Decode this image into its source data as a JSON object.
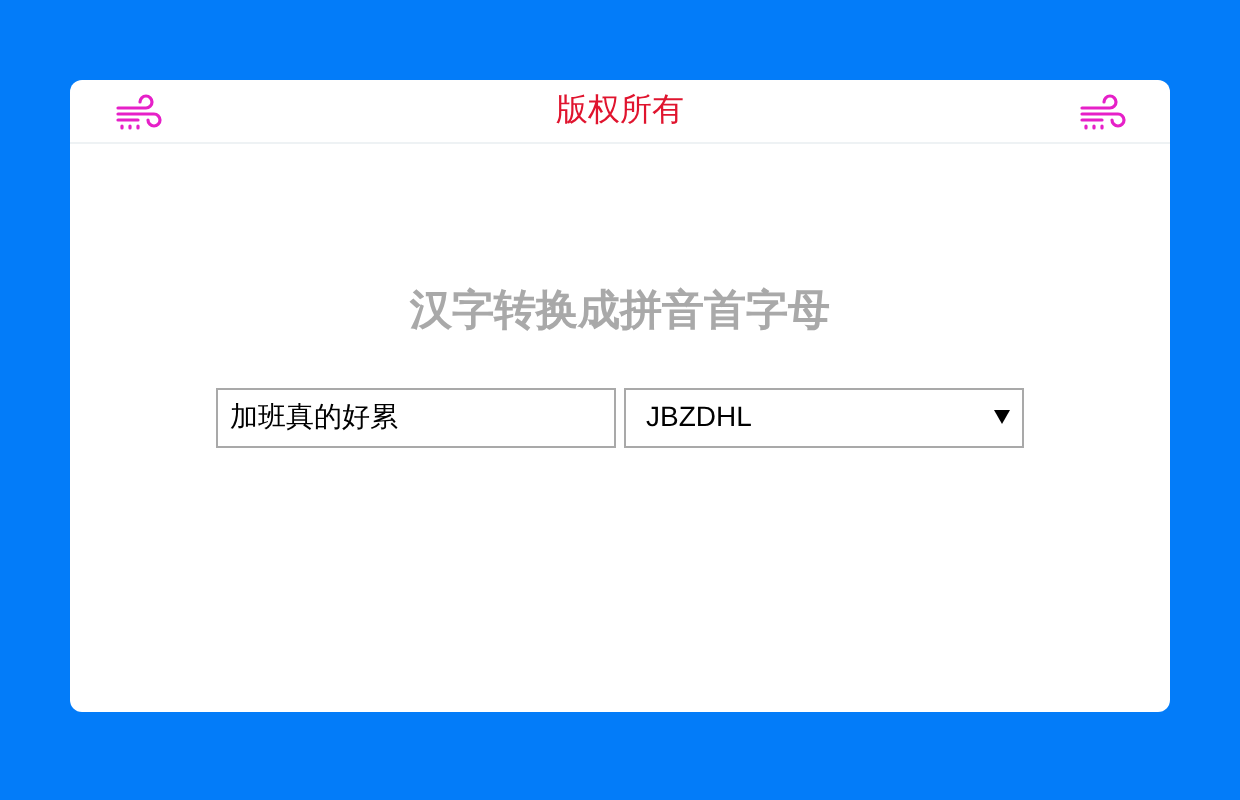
{
  "header": {
    "title": "版权所有"
  },
  "heading": "汉字转换成拼音首字母",
  "input": {
    "value": "加班真的好累"
  },
  "select": {
    "value": "JBZDHL"
  }
}
